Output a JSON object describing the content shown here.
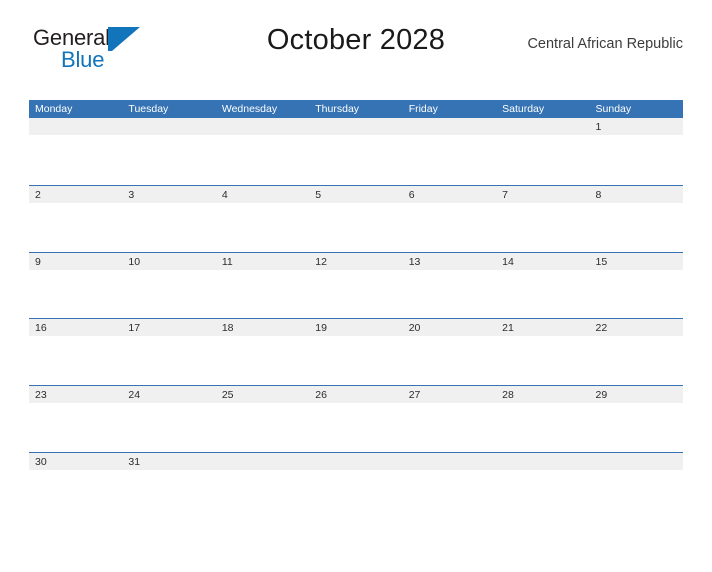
{
  "header": {
    "logo": {
      "word_primary": "General",
      "word_secondary": "Blue",
      "mark_name": "general-blue-sail-logo",
      "color_primary": "#231f20",
      "color_secondary": "#1275bc"
    },
    "title": "October 2028",
    "locale": "Central African Republic"
  },
  "calendar": {
    "header_color": "#3573b4",
    "band_color": "#f0f0f0",
    "weekdays": [
      "Monday",
      "Tuesday",
      "Wednesday",
      "Thursday",
      "Friday",
      "Saturday",
      "Sunday"
    ],
    "weeks": [
      [
        "",
        "",
        "",
        "",
        "",
        "",
        "1"
      ],
      [
        "2",
        "3",
        "4",
        "5",
        "6",
        "7",
        "8"
      ],
      [
        "9",
        "10",
        "11",
        "12",
        "13",
        "14",
        "15"
      ],
      [
        "16",
        "17",
        "18",
        "19",
        "20",
        "21",
        "22"
      ],
      [
        "23",
        "24",
        "25",
        "26",
        "27",
        "28",
        "29"
      ],
      [
        "30",
        "31",
        "",
        "",
        "",
        "",
        ""
      ]
    ]
  }
}
